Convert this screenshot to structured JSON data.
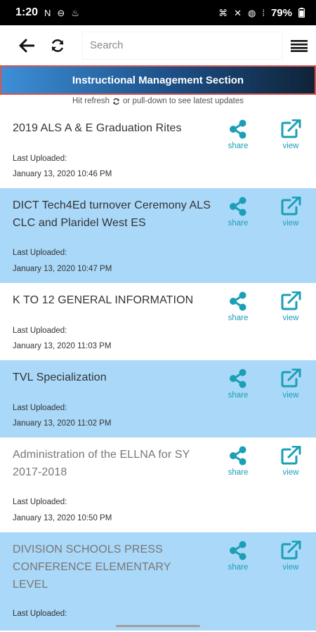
{
  "status_bar": {
    "time": "1:20",
    "left_icons": [
      "N",
      "⊖",
      "♨"
    ],
    "right_icons": [
      "⌘",
      "✕",
      "◍",
      "⁞"
    ],
    "battery": "79%"
  },
  "toolbar": {
    "search_placeholder": "Search",
    "back_icon": "arrow-left-icon",
    "refresh_icon": "refresh-icon",
    "menu_icon": "hamburger-menu-icon"
  },
  "section": {
    "title": "Instructional Management Section"
  },
  "hint": {
    "before": "Hit refresh",
    "after": "or pull-down to see latest updates"
  },
  "labels": {
    "share": "share",
    "view": "view",
    "last_uploaded": "Last Uploaded:"
  },
  "colors": {
    "accent": "#1a9fb6",
    "row_highlight": "#aad8f8",
    "header_gradient_start": "#3d8fd9",
    "header_gradient_end": "#0f2338",
    "header_border": "#d9534f"
  },
  "items": [
    {
      "title": "2019 ALS A & E Graduation Rites",
      "date": "January 13, 2020 10:46 PM",
      "style": "white"
    },
    {
      "title": "DICT Tech4Ed turnover Ceremony ALS CLC and Plaridel West ES",
      "date": "January 13, 2020 10:47 PM",
      "style": "blue"
    },
    {
      "title": "K TO 12 GENERAL INFORMATION",
      "date": "January 13, 2020 11:03 PM",
      "style": "white"
    },
    {
      "title": "TVL Specialization",
      "date": "January 13, 2020 11:02 PM",
      "style": "blue"
    },
    {
      "title": "Administration of the ELLNA for SY 2017-2018",
      "date": "January 13, 2020 10:50 PM",
      "style": "white"
    },
    {
      "title": "DIVISION SCHOOLS PRESS CONFERENCE ELEMENTARY LEVEL",
      "date": "",
      "style": "blue"
    }
  ]
}
